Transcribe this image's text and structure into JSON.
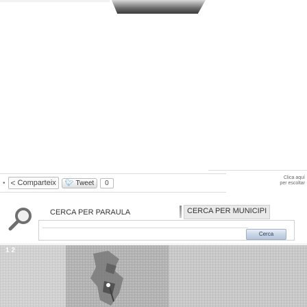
{
  "share": {
    "share_label": "Comparteix",
    "tweet_label": "Tweet",
    "tweet_count": "0",
    "clic_line1": "Clica aquí",
    "clic_line2": "per escoltar"
  },
  "search": {
    "tab_word_label": "CERCA PER PARAULA",
    "tab_municipi_label": "CERCA PER MUNICIPI",
    "input_value": "",
    "go_label": "Cerca"
  },
  "map": {
    "zoom_label": "1 2"
  },
  "colors": {
    "accent_blue": "#b4c6db",
    "map_gray": "#bcbcbc"
  }
}
